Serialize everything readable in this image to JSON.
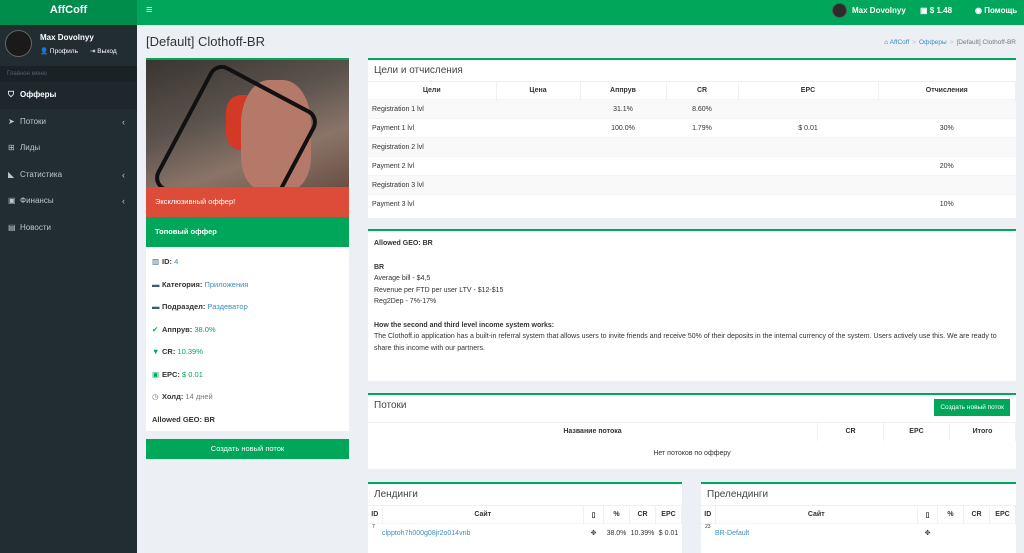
{
  "topbar": {
    "logo": "AffCoff",
    "user": "Max Dovolnyy",
    "balance": "$ 1.48",
    "help": "Помощь"
  },
  "sidebar": {
    "user": "Max Dovolnyy",
    "profile": "Профиль",
    "logout": "Выход",
    "header": "Главное меню",
    "items": [
      {
        "label": "Офферы",
        "icon": "tag-icon"
      },
      {
        "label": "Потоки",
        "icon": "paper-plane-icon"
      },
      {
        "label": "Лиды",
        "icon": "cart-icon"
      },
      {
        "label": "Статистика",
        "icon": "area-chart-icon"
      },
      {
        "label": "Финансы",
        "icon": "money-icon"
      },
      {
        "label": "Новости",
        "icon": "newspaper-icon"
      }
    ]
  },
  "page": {
    "title": "[Default] Clothoff-BR",
    "bc_home": "AffCoff",
    "bc_offers": "Офферы",
    "bc_current": "[Default] Clothoff-BR"
  },
  "offer": {
    "exclusive": "Эксклюзивный оффер!",
    "top": "Топовый оффер",
    "id_label": "ID:",
    "id": "4",
    "cat_label": "Категория:",
    "cat": "Приложения",
    "sub_label": "Подраздел:",
    "sub": "Раздеватор",
    "appr_label": "Аппрув:",
    "appr": "38.0%",
    "cr_label": "CR:",
    "cr": "10.39%",
    "epc_label": "EPC:",
    "epc": "$ 0.01",
    "hold_label": "Холд:",
    "hold": "14 дней",
    "geo": "Allowed GEO: BR",
    "create": "Создать новый поток"
  },
  "goals": {
    "title": "Цели и отчисления",
    "headers": [
      "Цели",
      "Цена",
      "Аппрув",
      "CR",
      "EPC",
      "Отчисления"
    ],
    "rows": [
      [
        "Registration 1 lvl",
        "",
        "31.1%",
        "8.60%",
        "",
        ""
      ],
      [
        "Payment 1 lvl",
        "",
        "100.0%",
        "1.79%",
        "$ 0.01",
        "30%"
      ],
      [
        "Registration 2 lvl",
        "",
        "",
        "",
        "",
        ""
      ],
      [
        "Payment 2 lvl",
        "",
        "",
        "",
        "",
        "20%"
      ],
      [
        "Registration 3 lvl",
        "",
        "",
        "",
        "",
        ""
      ],
      [
        "Payment 3 lvl",
        "",
        "",
        "",
        "",
        "10%"
      ]
    ]
  },
  "geo": {
    "allowed": "Allowed GEO: BR",
    "country": "BR",
    "l1": "Average bill - $4,5",
    "l2": "Revenue per FTD per user LTV - $12-$15",
    "l3": "Reg2Dep - 7%-17%",
    "q": "How the second and third level income system works:",
    "p": "The Clothoff.io application has a built-in referral system that allows users to invite friends and receive 50% of their deposits in the internal currency of the system. Users actively use this. We are ready to share this income with our partners."
  },
  "streams": {
    "title": "Потоки",
    "create": "Создать новый поток",
    "headers": [
      "Название потока",
      "CR",
      "EPC",
      "Итого"
    ],
    "empty": "Нет потоков по офферу"
  },
  "landings": {
    "title": "Лендинги",
    "headers": [
      "ID",
      "Сайт",
      "",
      "%",
      "CR",
      "EPC"
    ],
    "row": {
      "id": "7",
      "site": "clpptoh7h000g08jr2o014vnb",
      "pct": "38.0%",
      "cr": "10.39%",
      "epc": "$ 0.01"
    }
  },
  "prelandings": {
    "title": "Прелендинги",
    "headers": [
      "ID",
      "Сайт",
      "",
      "%",
      "CR",
      "EPC"
    ],
    "row": {
      "id": "23",
      "site": "BR-Default"
    }
  }
}
